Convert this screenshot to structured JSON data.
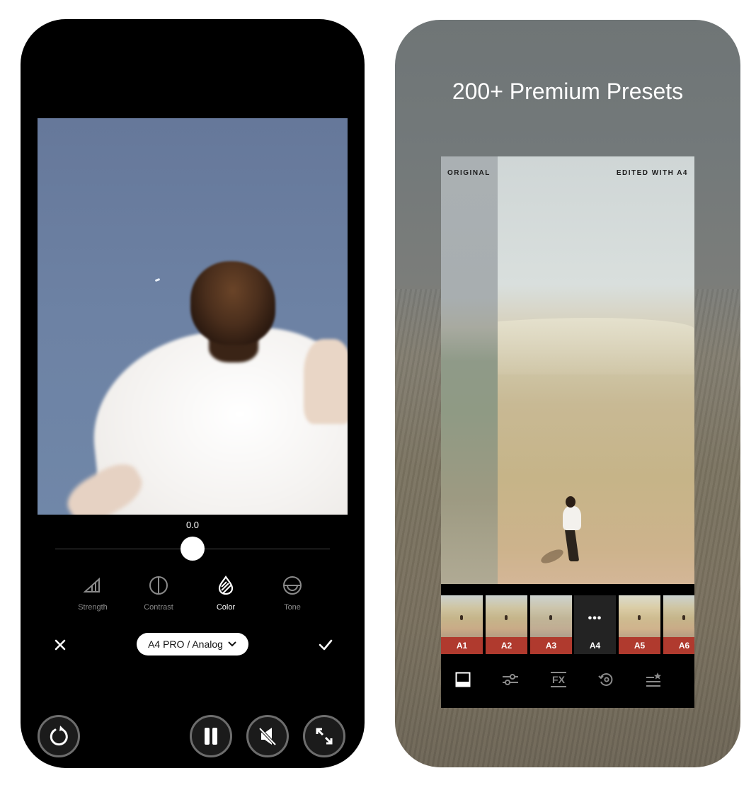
{
  "left_screen": {
    "slider": {
      "value_label": "0.0",
      "value": 0.0,
      "range": [
        -100,
        100
      ]
    },
    "tools": [
      {
        "label": "Strength",
        "icon": "strength-icon",
        "active": false
      },
      {
        "label": "Contrast",
        "icon": "contrast-icon",
        "active": false
      },
      {
        "label": "Color",
        "icon": "color-drop-icon",
        "active": true
      },
      {
        "label": "Tone",
        "icon": "tone-icon",
        "active": false
      }
    ],
    "preset_selector": {
      "label": "A4 PRO / Analog",
      "icon": "chevron-down-icon"
    },
    "cancel_icon": "close-icon",
    "confirm_icon": "checkmark-icon",
    "playback_controls": [
      {
        "name": "replay",
        "icon": "replay-icon"
      },
      {
        "name": "pause",
        "icon": "pause-icon"
      },
      {
        "name": "mute",
        "icon": "speaker-muted-icon"
      },
      {
        "name": "fullscreen",
        "icon": "expand-icon"
      }
    ]
  },
  "right_screen": {
    "headline": "200+ Premium Presets",
    "compare": {
      "original_label": "ORIGINAL",
      "edited_label": "EDITED WITH A4"
    },
    "presets": [
      {
        "label": "A1",
        "selected": false
      },
      {
        "label": "A2",
        "selected": false
      },
      {
        "label": "A3",
        "selected": false
      },
      {
        "label": "A4",
        "selected": true,
        "overlay": "•••"
      },
      {
        "label": "A5",
        "selected": false
      },
      {
        "label": "A6",
        "selected": false
      }
    ],
    "toolbar": [
      {
        "name": "presets",
        "icon": "preset-frame-icon",
        "active": true
      },
      {
        "name": "adjust",
        "icon": "sliders-icon",
        "active": false
      },
      {
        "name": "fx",
        "icon": "fx-icon",
        "active": false,
        "text": "FX"
      },
      {
        "name": "history",
        "icon": "history-icon",
        "active": false
      },
      {
        "name": "favorites",
        "icon": "favorites-list-icon",
        "active": false
      }
    ],
    "colors": {
      "preset_tag": "#b03a2e",
      "selected_tag": "#232323"
    }
  }
}
